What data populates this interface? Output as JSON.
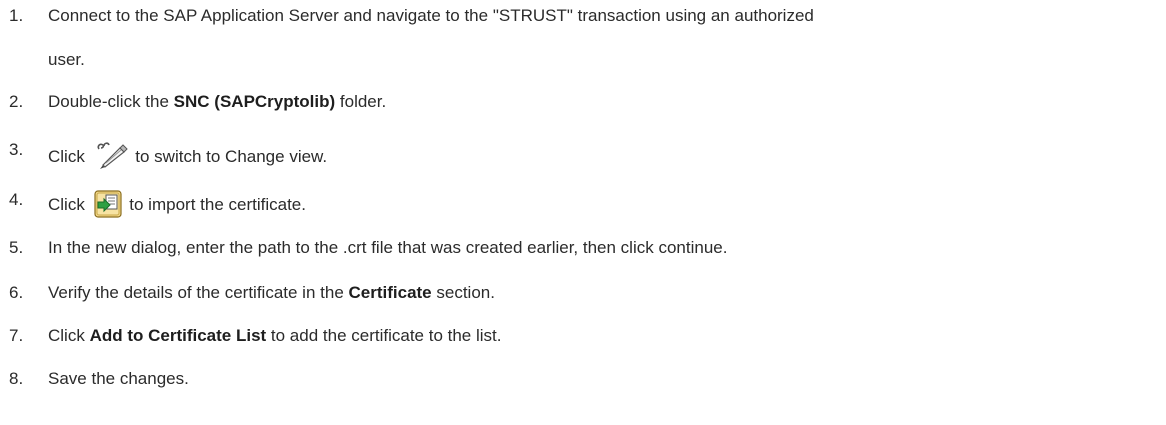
{
  "steps": [
    {
      "number": "1.",
      "line1": "Connect to the SAP Application Server and navigate to the \"STRUST\" transaction using an authorized",
      "line2": "user."
    },
    {
      "number": "2.",
      "pre": "Double-click the ",
      "bold": "SNC (SAPCryptolib)",
      "post": " folder."
    },
    {
      "number": "3.",
      "pre": "Click ",
      "icon": "pencil-change-icon",
      "post": " to switch to Change view."
    },
    {
      "number": "4.",
      "pre": "Click ",
      "icon": "import-certificate-icon",
      "post": " to import the certificate."
    },
    {
      "number": "5.",
      "text": "In the new dialog, enter the path to the .crt file that was created earlier, then click continue."
    },
    {
      "number": "6.",
      "pre": "Verify the details of the certificate in the ",
      "bold": "Certificate",
      "post": " section."
    },
    {
      "number": "7.",
      "pre": "Click ",
      "bold": "Add to Certificate List",
      "post": " to add the certificate to the list."
    },
    {
      "number": "8.",
      "text": "Save the changes."
    }
  ]
}
